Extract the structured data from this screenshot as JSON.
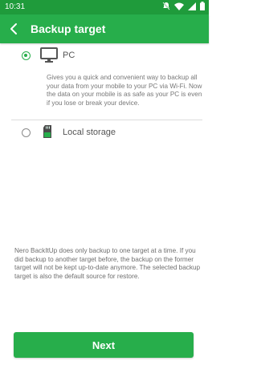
{
  "status_bar": {
    "time": "10:31"
  },
  "app_bar": {
    "title": "Backup target"
  },
  "options": [
    {
      "label": "PC",
      "selected": true,
      "icon": "monitor-icon",
      "description": "Gives you a quick and convenient way to backup all your data from your mobile to your PC via Wi-Fi. Now the data on your mobile is as safe as your PC is even if you lose or break your device."
    },
    {
      "label": "Local storage",
      "selected": false,
      "icon": "sd-card-icon"
    }
  ],
  "info_text": "Nero BackItUp does only backup to one target at a time. If you did backup to another target before, the backup on the former target will not be kept up-to-date anymore. The selected backup target is also the default source for restore.",
  "next_button": {
    "label": "Next"
  },
  "colors": {
    "accent": "#27ae4b",
    "status_bar": "#1f9b3b"
  }
}
